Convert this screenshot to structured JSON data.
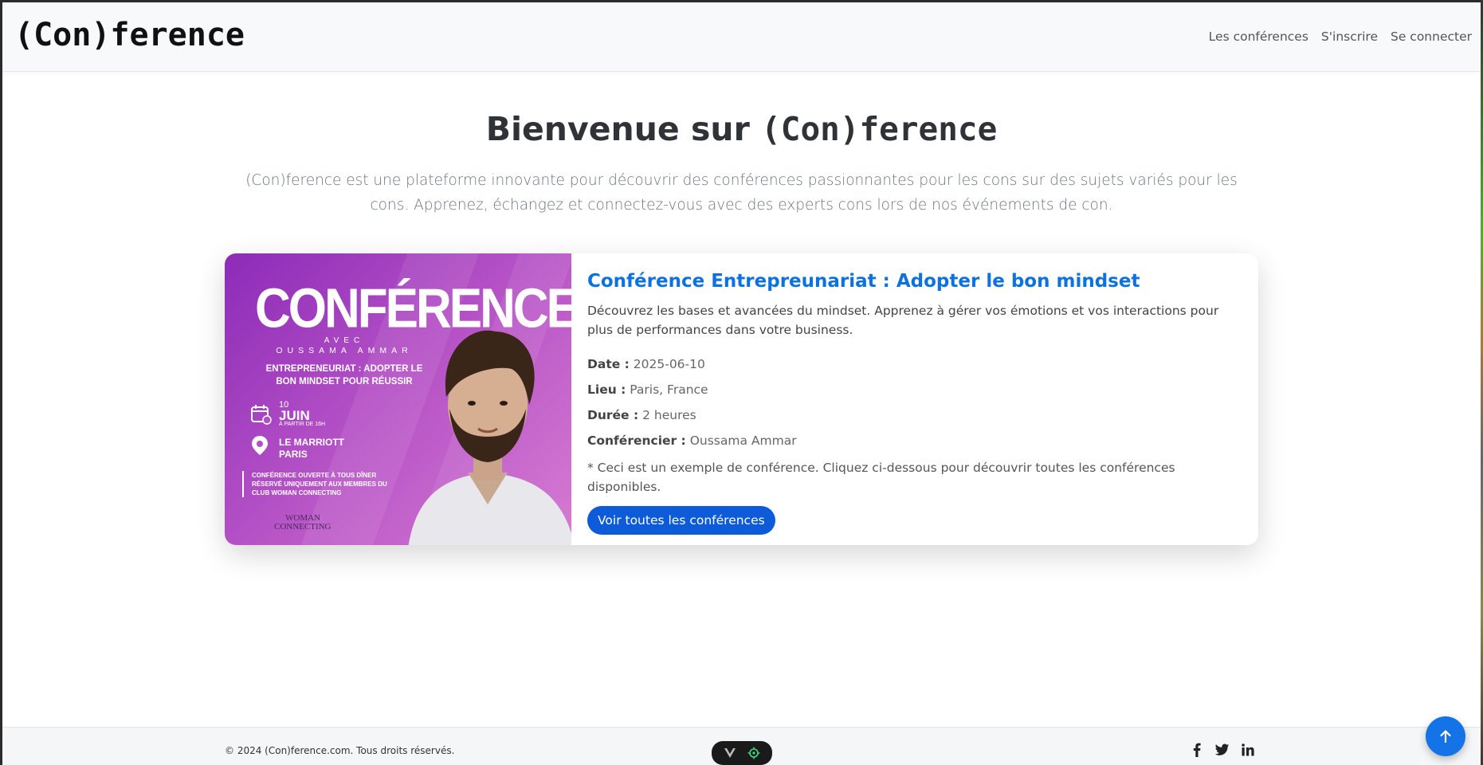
{
  "navbar": {
    "brand": "(Con)ference",
    "links": [
      "Les conférences",
      "S'inscrire",
      "Se connecter"
    ]
  },
  "hero": {
    "title_prefix": "Bienvenue sur",
    "title_brand": "(Con)ference",
    "description": "(Con)ference est une plateforme innovante pour découvrir des conférences passionnantes pour les cons sur des sujets variés pour les cons. Apprenez, échangez et connectez-vous avec des experts cons lors de nos événements de con."
  },
  "card": {
    "poster": {
      "headline": "CONFÉRENCE",
      "avec": "AVEC",
      "speaker": "OUSSAMA AMMAR",
      "subtitle": "ENTREPRENEURIAT : ADOPTER LE BON MINDSET POUR RÉUSSIR",
      "date_day": "10",
      "date_month": "JUIN",
      "date_time": "À PARTIR DE 16H",
      "place_line1": "LE MARRIOTT",
      "place_line2": "PARIS",
      "note": "CONFÉRENCE OUVERTE À TOUS DÎNER RÉSERVÉ UNIQUEMENT AUX MEMBRES DU CLUB WOMAN CONNECTING",
      "logo_line1": "WOMAN",
      "logo_line2": "CONNECTING"
    },
    "title": "Conférence Entrepreunariat : Adopter le bon mindset",
    "description": "Découvrez les bases et avancées du mindset. Apprenez à gérer vos émotions et vos interactions pour plus de performances dans votre business.",
    "date_label": "Date :",
    "date_value": "2025-06-10",
    "lieu_label": "Lieu :",
    "lieu_value": "Paris, France",
    "duree_label": "Durée :",
    "duree_value": "2 heures",
    "speaker_label": "Conférencier :",
    "speaker_value": "Oussama Ammar",
    "note": "* Ceci est un exemple de conférence. Cliquez ci-dessous pour découvrir toutes les conférences disponibles.",
    "button_label": "Voir toutes les conférences"
  },
  "footer": {
    "copyright": "© 2024 (Con)ference.com. Tous droits réservés.",
    "socials": [
      "facebook-icon",
      "twitter-icon",
      "linkedin-icon"
    ]
  },
  "colors": {
    "accent": "#0d72e0",
    "button": "#0d5bd8",
    "scroll_button": "#1473e6"
  }
}
